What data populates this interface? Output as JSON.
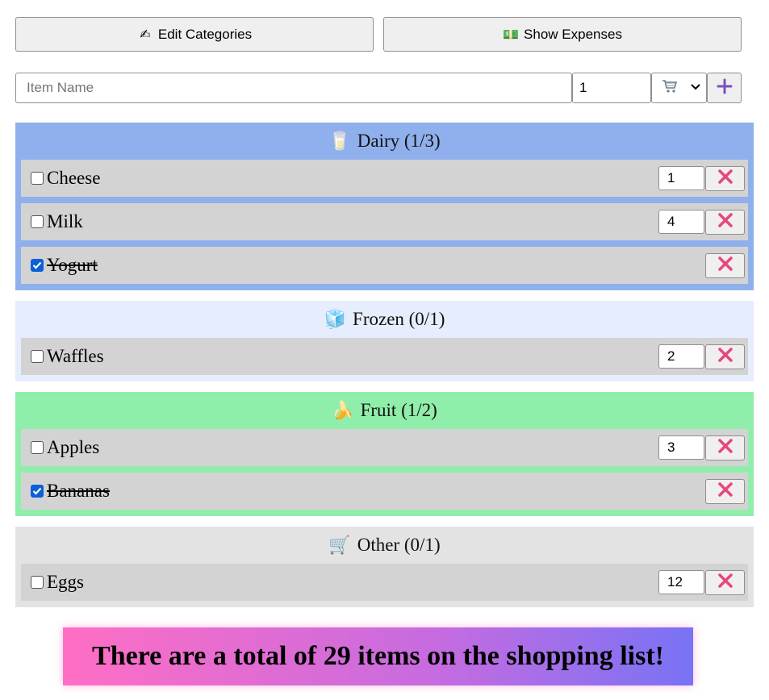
{
  "toolbar": {
    "edit_categories": {
      "icon": "writing-hand-icon",
      "glyph": "✍",
      "label": "Edit Categories"
    },
    "show_expenses": {
      "icon": "money-icon",
      "glyph": "💵",
      "label": "Show Expenses"
    }
  },
  "add_form": {
    "item_name_placeholder": "Item Name",
    "quantity_value": "1",
    "category_selected_icon": "shopping-cart-icon",
    "add_icon": "plus-icon"
  },
  "colors": {
    "dairy": "#8fb0ec",
    "frozen": "#e6edfd",
    "fruit": "#90eeab",
    "other": "#e3e3e3",
    "delete": "#e8467c",
    "add": "#7b4fbd"
  },
  "categories": [
    {
      "name": "Dairy (1/3)",
      "icon": "milk-glass-icon",
      "glyph": "🥛",
      "items": [
        {
          "name": "Cheese",
          "checked": false,
          "qty": "1"
        },
        {
          "name": "Milk",
          "checked": false,
          "qty": "4"
        },
        {
          "name": "Yogurt",
          "checked": true,
          "qty": ""
        }
      ]
    },
    {
      "name": "Frozen (0/1)",
      "icon": "ice-cube-icon",
      "glyph": "🧊",
      "items": [
        {
          "name": "Waffles",
          "checked": false,
          "qty": "2"
        }
      ]
    },
    {
      "name": "Fruit (1/2)",
      "icon": "banana-icon",
      "glyph": "🍌",
      "items": [
        {
          "name": "Apples",
          "checked": false,
          "qty": "3"
        },
        {
          "name": "Bananas",
          "checked": true,
          "qty": ""
        }
      ]
    },
    {
      "name": "Other (0/1)",
      "icon": "shopping-cart-icon",
      "glyph": "🛒",
      "items": [
        {
          "name": "Eggs",
          "checked": false,
          "qty": "12"
        }
      ]
    }
  ],
  "summary": "There are a total of 29 items on the shopping list!"
}
